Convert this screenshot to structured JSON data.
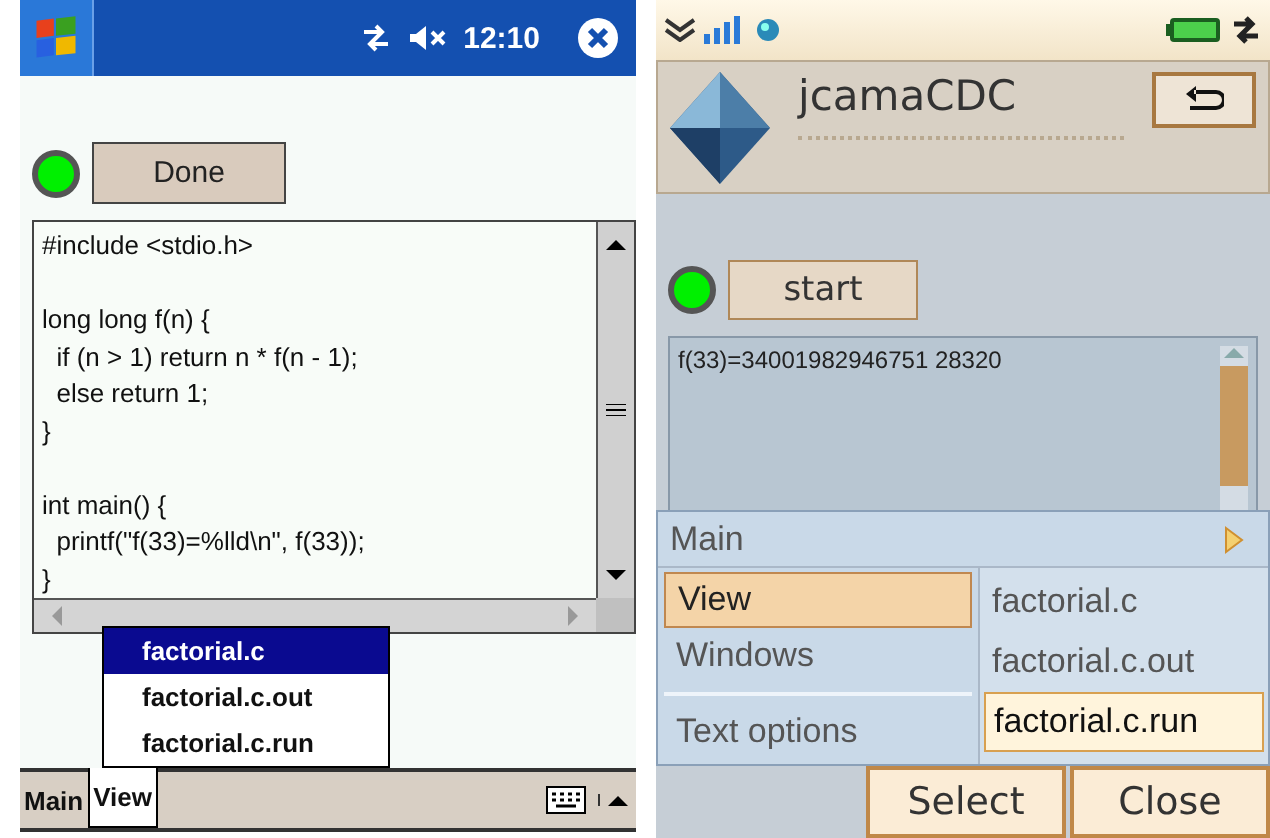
{
  "left_screen": {
    "status_bar": {
      "time": "12:10"
    },
    "done_button": "Done",
    "editor": {
      "blocks": [
        [
          "#include <stdio.h>"
        ],
        [
          "long long f(n) {",
          "  if (n > 1) return n * f(n - 1);",
          "  else return 1;",
          "}"
        ],
        [
          "int main() {",
          "  printf(\"f(33)=%lld\\n\", f(33));",
          "}"
        ]
      ]
    },
    "popup_menu": [
      {
        "label": "factorial.c",
        "selected": true
      },
      {
        "label": "factorial.c.out",
        "selected": false
      },
      {
        "label": "factorial.c.run",
        "selected": false
      }
    ],
    "tabs": [
      {
        "label": "Main",
        "selected": false
      },
      {
        "label": "View",
        "selected": true
      }
    ]
  },
  "right_screen": {
    "app_title": "jcamaCDC",
    "start_button": "start",
    "output": "f(33)=34001982946751 28320",
    "menu": [
      {
        "label": "Main",
        "selected": false,
        "submenu": true
      },
      {
        "label": "View",
        "selected": true,
        "submenu": false
      },
      {
        "label": "Windows",
        "selected": false,
        "submenu": false
      },
      {
        "label": "Text options",
        "selected": false,
        "submenu": false
      }
    ],
    "submenu": [
      {
        "label": "factorial.c",
        "selected": false
      },
      {
        "label": "factorial.c.out",
        "selected": false
      },
      {
        "label": "factorial.c.run",
        "selected": true
      }
    ],
    "buttons": [
      "Select",
      "Close"
    ]
  }
}
